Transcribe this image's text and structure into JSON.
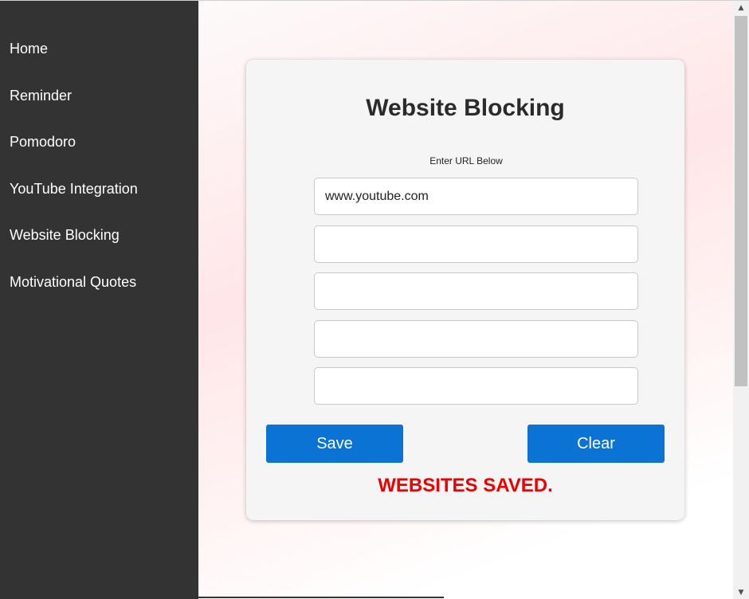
{
  "sidebar": {
    "items": [
      {
        "label": "Home"
      },
      {
        "label": "Reminder"
      },
      {
        "label": "Pomodoro"
      },
      {
        "label": "YouTube Integration"
      },
      {
        "label": "Website Blocking"
      },
      {
        "label": "Motivational Quotes"
      }
    ]
  },
  "card": {
    "title": "Website Blocking",
    "url_label": "Enter URL Below",
    "inputs": [
      {
        "value": "www.youtube.com"
      },
      {
        "value": ""
      },
      {
        "value": ""
      },
      {
        "value": ""
      },
      {
        "value": ""
      }
    ],
    "save_label": "Save",
    "clear_label": "Clear",
    "status": "WEBSITES SAVED."
  },
  "colors": {
    "sidebar_bg": "#333333",
    "button": "#0a73d3",
    "status": "#ee0000"
  }
}
